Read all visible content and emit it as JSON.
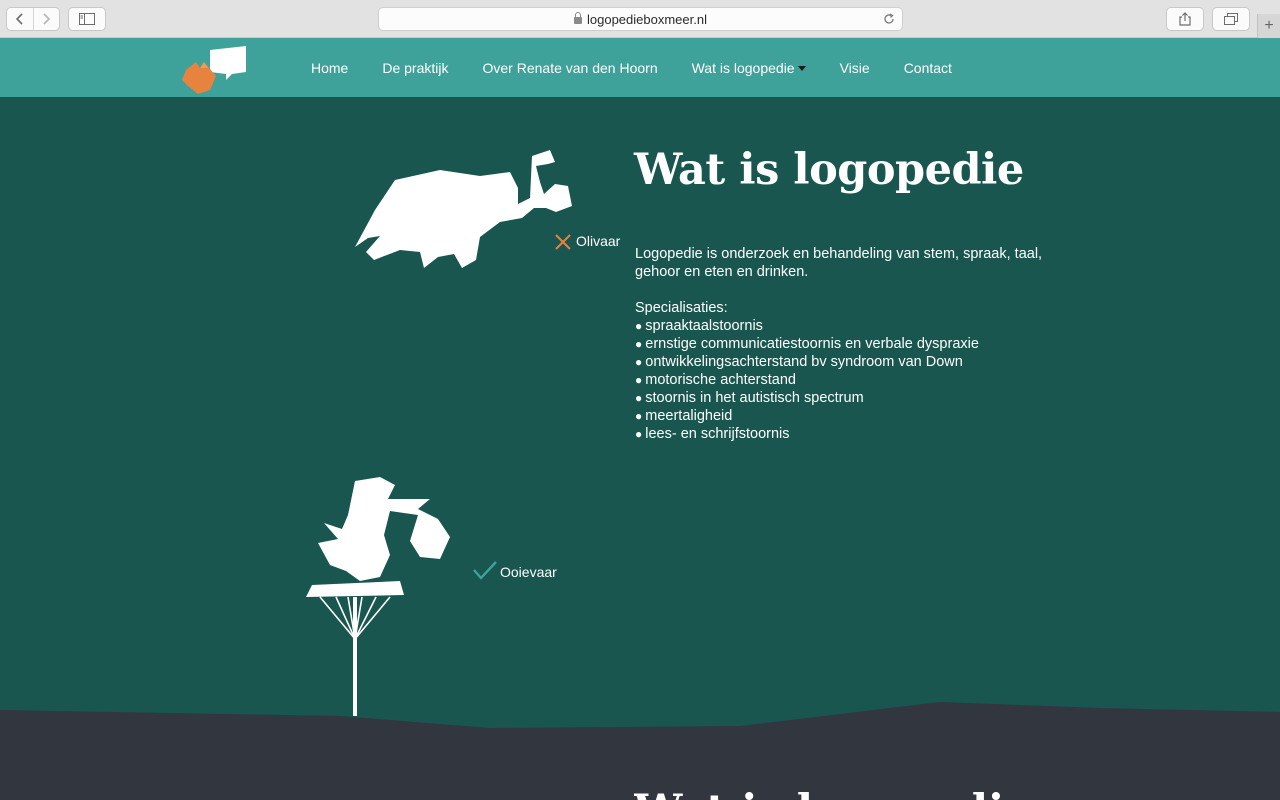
{
  "browser": {
    "url": "logopedieboxmeer.nl",
    "back_icon": "chevron-left-icon",
    "forward_icon": "chevron-right-icon",
    "sidebar_icon": "sidebar-icon",
    "reload_icon": "reload-icon",
    "share_icon": "share-icon",
    "tabs_icon": "tabs-icon",
    "new_tab_icon": "plus-icon"
  },
  "header": {
    "logo_icon": "speech-bubble-fox-logo",
    "nav": [
      {
        "label": "Home"
      },
      {
        "label": "De praktijk"
      },
      {
        "label": "Over Renate van den Hoorn"
      },
      {
        "label": "Wat is logopedie"
      },
      {
        "label": "Visie"
      },
      {
        "label": "Contact"
      }
    ]
  },
  "main": {
    "title": "Wat is logopedie",
    "intro": "Logopedie is onderzoek en behandeling van stem, spraak, taal, gehoor en eten en drinken.",
    "specialisaties_title": "Specialisaties:",
    "specialisaties": [
      "spraaktaalstoornis",
      "ernstige communicatiestoornis en verbale dyspraxie",
      "ontwikkelingsachterstand bv syndroom van Down",
      "motorische achterstand",
      "stoornis in het autistisch spectrum",
      "meertaligheid",
      "lees- en schrijfstoornis"
    ],
    "illustration_wrong": {
      "label": "Olivaar",
      "icon": "cross-icon"
    },
    "illustration_right": {
      "label": "Ooievaar",
      "icon": "check-icon"
    }
  },
  "next_section": {
    "title": "Wat is logopedie"
  },
  "colors": {
    "header_bg": "#3ea29a",
    "main_bg": "#18564f",
    "dark_band": "#32363f",
    "accent_orange": "#e8833f",
    "accent_teal": "#3ea29a"
  }
}
